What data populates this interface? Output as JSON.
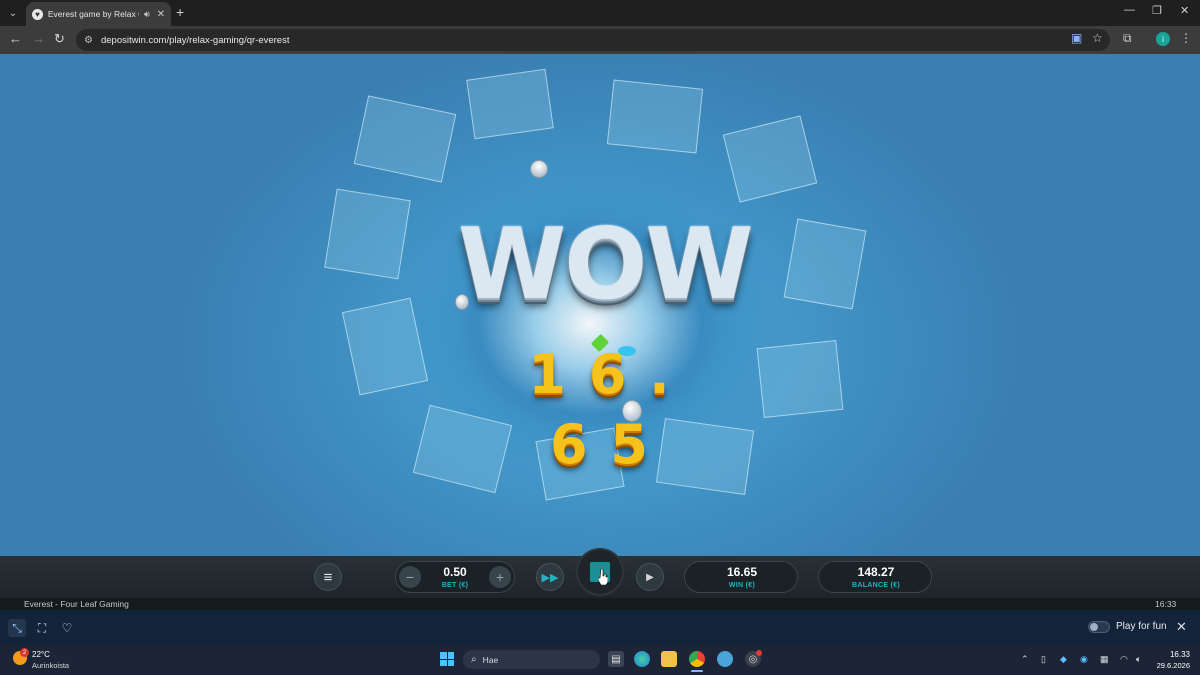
{
  "browser": {
    "tab_title": "Everest game by Relax Gam",
    "url": "depositwin.com/play/relax-gaming/qr-everest",
    "new_tab": "+",
    "minimize": "—",
    "restore": "❐",
    "close": "✕",
    "profile_initial": "i"
  },
  "game": {
    "headline": "WOW",
    "win_amount": "16.65",
    "bet_value": "0.50",
    "bet_label": "BET (€)",
    "win_value": "16.65",
    "win_label": "WIN (€)",
    "balance_value": "148.27",
    "balance_label": "BALANCE (€)",
    "minus": "−",
    "plus": "+"
  },
  "game_footer": {
    "name": "Everest - Four Leaf Gaming",
    "time": "16:33"
  },
  "site_bar": {
    "play_for_fun_label": "Play for fun",
    "play_for_fun_on": false
  },
  "taskbar": {
    "weather_badge": "2",
    "temperature": "22°C",
    "condition": "Aurinkoista",
    "search_placeholder": "Hae",
    "time": "16.33",
    "date": "29.6.2026"
  },
  "colors": {
    "accent_teal": "#1db6c2",
    "win_gold": "#f6c21c",
    "browser_bg": "#3c3c3c",
    "taskbar_bg": "#1c2536"
  }
}
